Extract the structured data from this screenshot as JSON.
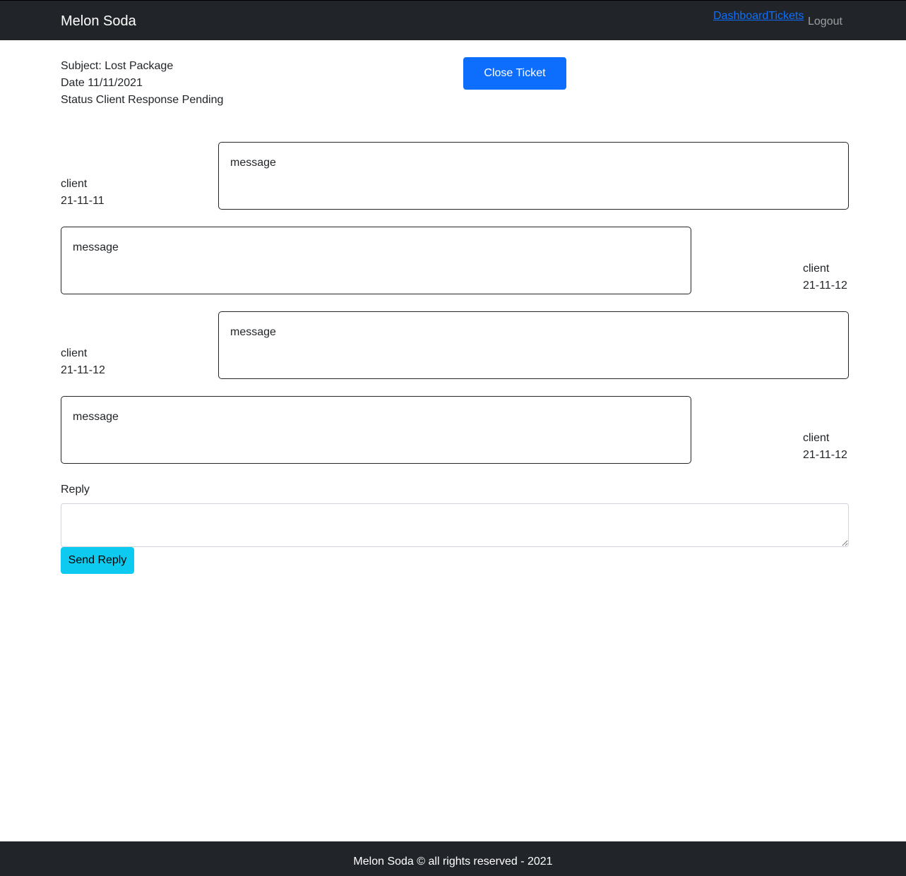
{
  "navbar": {
    "brand": "Melon Soda",
    "links": [
      "Dashboard",
      "Tickets"
    ],
    "logout": "Logout"
  },
  "ticket": {
    "subject": "Subject: Lost Package",
    "date": "Date 11/11/2021",
    "status": "Status Client Response Pending",
    "close_button": "Close Ticket"
  },
  "messages": [
    {
      "text": "message",
      "author": "client",
      "date": "21-11-11"
    },
    {
      "text": "message",
      "author": "client",
      "date": "21-11-12"
    },
    {
      "text": "message",
      "author": "client",
      "date": "21-11-12"
    },
    {
      "text": "message",
      "author": "client",
      "date": "21-11-12"
    }
  ],
  "reply": {
    "label": "Reply",
    "value": "",
    "send_button": "Send Reply"
  },
  "footer": {
    "text": "Melon Soda © all rights reserved - 2021"
  }
}
